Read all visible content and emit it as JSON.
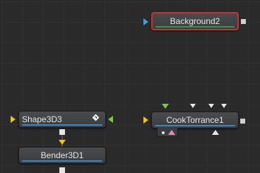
{
  "flow": {
    "nodes": {
      "background": {
        "label": "Background2",
        "selected": true
      },
      "shape": {
        "label": "Shape3D3"
      },
      "bender": {
        "label": "Bender3D1"
      },
      "cook": {
        "label": "CookTorrance1"
      }
    },
    "colors": {
      "canvas": "#2a2a2a",
      "grid": "#303030",
      "node_body": "#444548",
      "selected_outline": "#c8322f",
      "underline_blue": "#3a86c8",
      "underline_green": "#2f9a4a",
      "input_yellow": "#f1c21b",
      "input_green": "#7ac943",
      "input_blue": "#3ba2e0",
      "input_white": "#e8e8e8",
      "mask_pink": "#e88ab2",
      "output_square": "#d8d8d8"
    }
  }
}
